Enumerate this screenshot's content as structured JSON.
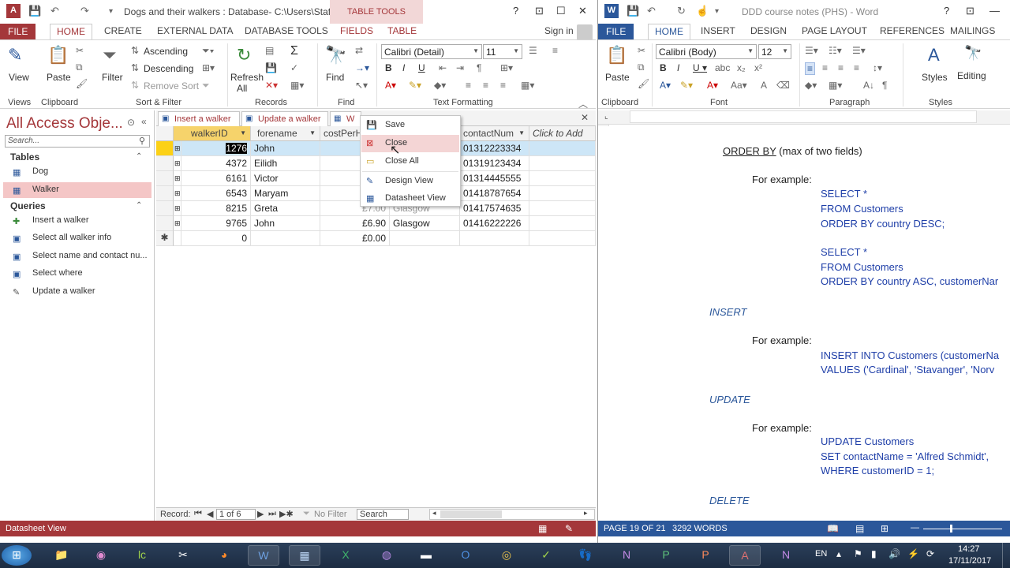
{
  "access": {
    "title": "Dogs and their walkers : Database- C:\\Users\\Staff...",
    "context_tab_group": "TABLE TOOLS",
    "tabs": [
      "FILE",
      "HOME",
      "CREATE",
      "EXTERNAL DATA",
      "DATABASE TOOLS",
      "FIELDS",
      "TABLE"
    ],
    "sign_in": "Sign in",
    "ribbon": {
      "view": "View",
      "paste": "Paste",
      "filter": "Filter",
      "ascending": "Ascending",
      "descending": "Descending",
      "remove_sort": "Remove Sort",
      "refresh": "Refresh",
      "refresh_all": "All",
      "find": "Find",
      "font_name": "Calibri (Detail)",
      "font_size": "11",
      "groups": [
        "Views",
        "Clipboard",
        "Sort & Filter",
        "Records",
        "Find",
        "Text Formatting"
      ]
    },
    "nav": {
      "title": "All Access Obje...",
      "search_placeholder": "Search...",
      "tables_header": "Tables",
      "tables": [
        "Dog",
        "Walker"
      ],
      "queries_header": "Queries",
      "queries": [
        "Insert a walker",
        "Select all walker info",
        "Select name and contact nu...",
        "Select where",
        "Update a walker"
      ]
    },
    "doc_tabs": [
      "Insert a walker",
      "Update a walker",
      "W"
    ],
    "grid": {
      "columns": [
        "walkerID",
        "forename",
        "costPerH",
        "",
        "contactNum",
        "Click to Add"
      ],
      "rows": [
        {
          "id": "1276",
          "forename": "John",
          "cost": "",
          "city": "",
          "contact": "01312223334"
        },
        {
          "id": "4372",
          "forename": "Eilidh",
          "cost": "",
          "city": "",
          "contact": "01319123434"
        },
        {
          "id": "6161",
          "forename": "Victor",
          "cost": "",
          "city": "",
          "contact": "01314445555"
        },
        {
          "id": "6543",
          "forename": "Maryam",
          "cost": "",
          "city": "",
          "contact": "01418787654"
        },
        {
          "id": "8215",
          "forename": "Greta",
          "cost": "£7.00",
          "city": "Glasgow",
          "contact": "01417574635"
        },
        {
          "id": "9765",
          "forename": "John",
          "cost": "£6.90",
          "city": "Glasgow",
          "contact": "01416222226"
        }
      ],
      "new_row": {
        "id": "0",
        "cost": "£0.00"
      }
    },
    "context_menu": [
      "Save",
      "Close",
      "Close All",
      "Design View",
      "Datasheet View"
    ],
    "record_bar": {
      "label": "Record:",
      "position": "1 of 6",
      "filter": "No Filter",
      "search": "Search"
    },
    "status": "Datasheet View"
  },
  "word": {
    "title": "DDD course notes (PHS) - Word",
    "tabs": [
      "FILE",
      "HOME",
      "INSERT",
      "DESIGN",
      "PAGE LAYOUT",
      "REFERENCES",
      "MAILINGS"
    ],
    "ribbon": {
      "paste": "Paste",
      "font_name": "Calibri (Body)",
      "font_size": "12",
      "styles": "Styles",
      "editing": "Editing",
      "groups": [
        "Clipboard",
        "Font",
        "Paragraph",
        "Styles"
      ]
    },
    "doc": {
      "orderby_heading": "ORDER BY",
      "orderby_note": " (max of two fields)",
      "for_example": "For example:",
      "ex1": [
        "SELECT *",
        "FROM Customers",
        "ORDER BY country DESC;"
      ],
      "ex2": [
        "SELECT *",
        "FROM Customers",
        "ORDER BY country ASC, customerNar"
      ],
      "insert_heading": "INSERT",
      "insert_ex": [
        "INSERT INTO Customers (customerNa",
        "VALUES ('Cardinal', 'Stavanger', 'Norv"
      ],
      "update_heading": "UPDATE",
      "update_ex": [
        "UPDATE Customers",
        "SET contactName = 'Alfred Schmidt',",
        "WHERE customerID = 1;"
      ],
      "delete_heading": "DELETE"
    },
    "status": {
      "page": "PAGE 19 OF 21",
      "words": "3292 WORDS"
    }
  },
  "taskbar": {
    "lang": "EN",
    "time": "14:27",
    "date": "17/11/2017"
  },
  "colors": {
    "access": "#a4373a",
    "word": "#2b579a",
    "selected_row": "#cde6f7",
    "record_selector": "#fcd116"
  }
}
